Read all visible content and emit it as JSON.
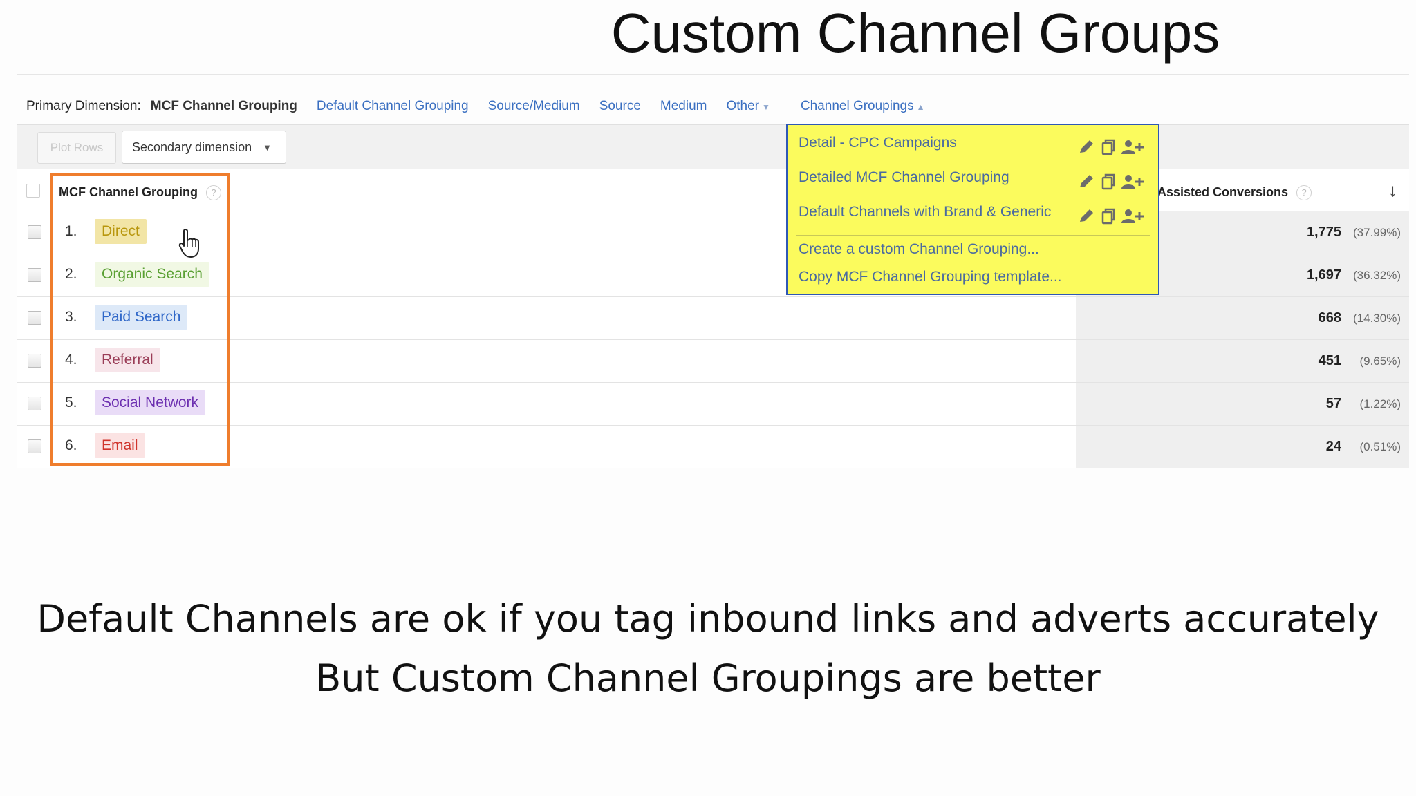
{
  "slide": {
    "title": "Custom Channel Groups",
    "caption_line1": "Default Channels are ok if you tag inbound links and adverts accurately",
    "caption_line2": "But Custom Channel Groupings are better"
  },
  "dimension_bar": {
    "label": "Primary Dimension:",
    "current": "MCF Channel Grouping",
    "links": [
      "Default Channel Grouping",
      "Source/Medium",
      "Source",
      "Medium",
      "Other"
    ],
    "channel_groupings": "Channel Groupings"
  },
  "toolbar": {
    "plot_rows": "Plot Rows",
    "secondary_dimension": "Secondary dimension"
  },
  "table": {
    "col_grouping": "MCF Channel Grouping",
    "col_metric": "Assisted Conversions",
    "help_glyph": "?",
    "rows": [
      {
        "num": "1.",
        "channel": "Direct",
        "value": "1,775",
        "pct": "(37.99%)",
        "color": "#f2e5a6",
        "text_color": "#b8960c"
      },
      {
        "num": "2.",
        "channel": "Organic Search",
        "value": "1,697",
        "pct": "(36.32%)",
        "color": "#f1f8e4",
        "text_color": "#5aa033"
      },
      {
        "num": "3.",
        "channel": "Paid Search",
        "value": "668",
        "pct": "(14.30%)",
        "color": "#dde9f8",
        "text_color": "#2f67c8"
      },
      {
        "num": "4.",
        "channel": "Referral",
        "value": "451",
        "pct": "(9.65%)",
        "color": "#f7e5ea",
        "text_color": "#9a3d57"
      },
      {
        "num": "5.",
        "channel": "Social Network",
        "value": "57",
        "pct": "(1.22%)",
        "color": "#e9dcf7",
        "text_color": "#6c2fb0"
      },
      {
        "num": "6.",
        "channel": "Email",
        "value": "24",
        "pct": "(0.51%)",
        "color": "#fbe3e3",
        "text_color": "#d0342c"
      }
    ]
  },
  "menu": {
    "items": [
      "Detail - CPC Campaigns",
      "Detailed MCF Channel Grouping",
      "Default Channels with Brand & Generic"
    ],
    "create": "Create a custom Channel Grouping...",
    "copy": "Copy MCF Channel Grouping template...",
    "icons": [
      "pencil-icon",
      "copy-icon",
      "share-user-icon"
    ]
  },
  "colors": {
    "highlight_border": "#ef7d2d",
    "menu_bg": "#fbfb5d",
    "menu_border": "#2f58b5",
    "link": "#3a6fc1"
  }
}
